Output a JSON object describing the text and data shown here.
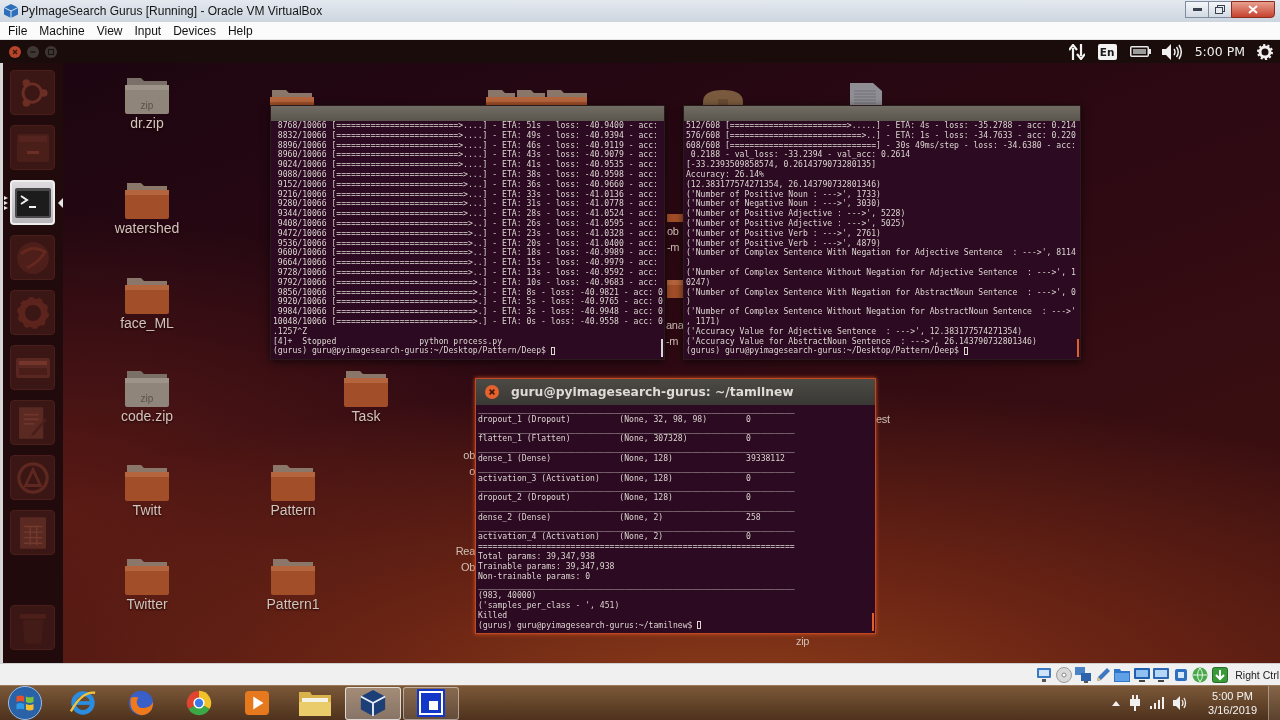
{
  "host_window": {
    "title": "PyImageSearch Gurus [Running] - Oracle VM VirtualBox"
  },
  "menu": [
    "File",
    "Machine",
    "View",
    "Input",
    "Devices",
    "Help"
  ],
  "ubuntu_panel": {
    "keyboard_layout": "En",
    "time": "5:00 PM"
  },
  "launcher": [
    {
      "kind": "dash",
      "selected": false
    },
    {
      "kind": "files",
      "selected": false
    },
    {
      "kind": "terminal",
      "selected": true
    },
    {
      "kind": "browser",
      "selected": false
    },
    {
      "kind": "settings",
      "selected": false
    },
    {
      "kind": "panel",
      "selected": false
    },
    {
      "kind": "editor",
      "selected": false
    },
    {
      "kind": "software",
      "selected": false
    },
    {
      "kind": "spreadsheet",
      "selected": false
    },
    {
      "kind": "trash",
      "selected": false
    }
  ],
  "desktop": {
    "icons": [
      {
        "kind": "zip",
        "label": "dr.zip",
        "icon_text": "zip"
      },
      {
        "kind": "folder"
      },
      {
        "kind": "folder"
      },
      {
        "kind": "folder"
      },
      {
        "kind": "folder"
      },
      {
        "kind": "drive"
      },
      {
        "kind": "file"
      },
      {
        "kind": "folder",
        "label": "watershed"
      },
      {
        "kind": "folder"
      },
      {
        "kind": "folder",
        "label": "face_ML"
      },
      {
        "kind": "folder"
      },
      {
        "kind": "zip",
        "label": "code.zip",
        "icon_text": "zip"
      },
      {
        "kind": "folder",
        "label": "Task"
      },
      {
        "kind": "folder",
        "label": "Twitt"
      },
      {
        "kind": "folder",
        "label": "Pattern"
      },
      {
        "kind": "folder",
        "label": "Twitter"
      },
      {
        "kind": "folder",
        "label": "Pattern1"
      }
    ],
    "label_fragments": [
      {
        "lines": [
          "ob",
          "-m"
        ]
      },
      {
        "lines": [
          "ana",
          "-m"
        ]
      },
      {
        "lines": [
          "est"
        ]
      },
      {
        "lines": [
          "ob",
          "o"
        ]
      },
      {
        "lines": [
          "Rea",
          "Ob"
        ]
      },
      {
        "lines": [
          "zip"
        ]
      }
    ]
  },
  "terminals": [
    {
      "focused": false,
      "lines": [
        " 8768/10066 [=========================>....] - ETA: 51s - loss: -40.9400 - acc:",
        " 8832/10066 [=========================>....] - ETA: 49s - loss: -40.9394 - acc:",
        " 8896/10066 [=========================>....] - ETA: 46s - loss: -40.9119 - acc:",
        " 8960/10066 [=========================>....] - ETA: 43s - loss: -40.9079 - acc:",
        " 9024/10066 [=========================>....] - ETA: 41s - loss: -40.9535 - acc:",
        " 9088/10066 [==========================>...] - ETA: 38s - loss: -40.9598 - acc:",
        " 9152/10066 [==========================>...] - ETA: 36s - loss: -40.9660 - acc:",
        " 9216/10066 [==========================>...] - ETA: 33s - loss: -41.0136 - acc:",
        " 9280/10066 [==========================>...] - ETA: 31s - loss: -41.0778 - acc:",
        " 9344/10066 [==========================>...] - ETA: 28s - loss: -41.0524 - acc:",
        " 9408/10066 [===========================>..] - ETA: 26s - loss: -41.0595 - acc:",
        " 9472/10066 [===========================>..] - ETA: 23s - loss: -41.0328 - acc:",
        " 9536/10066 [===========================>..] - ETA: 20s - loss: -41.0400 - acc:",
        " 9600/10066 [===========================>..] - ETA: 18s - loss: -40.9989 - acc:",
        " 9664/10066 [===========================>..] - ETA: 15s - loss: -40.9979 - acc:",
        " 9728/10066 [===========================>..] - ETA: 13s - loss: -40.9592 - acc:",
        " 9792/10066 [============================>.] - ETA: 10s - loss: -40.9683 - acc:",
        " 9856/10066 [============================>.] - ETA: 8s - loss: -40.9821 - acc: 0",
        " 9920/10066 [============================>.] - ETA: 5s - loss: -40.9765 - acc: 0",
        " 9984/10066 [============================>.] - ETA: 3s - loss: -40.9948 - acc: 0",
        "10048/10066 [============================>.] - ETA: 0s - loss: -40.9558 - acc: 0",
        ".1257^Z",
        "[4]+  Stopped                 python process.py",
        "(gurus) guru@pyimagesearch-gurus:~/Desktop/Pattern/Deep$"
      ]
    },
    {
      "focused": false,
      "lines": [
        "512/608 [========================>.....] - ETA: 4s - loss: -35.2788 - acc: 0.214",
        "576/608 [===========================>..] - ETA: 1s - loss: -34.7633 - acc: 0.220",
        "608/608 [==============================] - 30s 49ms/step - loss: -34.6380 - acc:",
        " 0.2188 - val_loss: -33.2394 - val_acc: 0.2614",
        "[-33.2393509858574, 0.2614379073280135]",
        "Accuracy: 26.14%",
        "(12.383177574271354, 26.143790732801346)",
        "('Number of Positive Noun : --->', 1733)",
        "('Number of Negative Noun : --->', 3030)",
        "('Number of Positive Adjective : --->', 5228)",
        "('Number of Positive Adjective : --->', 5025)",
        "('Number of Positive Verb : --->', 2761)",
        "('Number of Positive Verb : --->', 4879)",
        "('Number of Complex Sentence With Negation for Adjective Sentence  : --->', 8114",
        ")",
        "('Number of Complex Sentence Without Negation for Adjective Sentence  : --->', 1",
        "0247)",
        "('Number of Complex Sentence With Negation for AbstractNoun Sentence  : --->', 0",
        ")",
        "('Number of Complex Sentence Without Negation for AbstractNoun Sentence  : --->'",
        ", 1171)",
        "('Accuracy Value for Adjective Sentence  : --->', 12.383177574271354)",
        "('Accuracy Value for AbstractNoun Sentence  : --->', 26.143790732801346)",
        "(gurus) guru@pyimagesearch-gurus:~/Desktop/Pattern/Deep$"
      ]
    },
    {
      "focused": true,
      "title": "guru@pyimagesearch-gurus: ~/tamilnew",
      "lines": [
        "_________________________________________________________________",
        "dropout_1 (Dropout)          (None, 32, 98, 98)        0",
        "_________________________________________________________________",
        "flatten_1 (Flatten)          (None, 307328)            0",
        "_________________________________________________________________",
        "dense_1 (Dense)              (None, 128)               39338112",
        "_________________________________________________________________",
        "activation_3 (Activation)    (None, 128)               0",
        "_________________________________________________________________",
        "dropout_2 (Dropout)          (None, 128)               0",
        "_________________________________________________________________",
        "dense_2 (Dense)              (None, 2)                 258",
        "_________________________________________________________________",
        "activation_4 (Activation)    (None, 2)                 0",
        "=================================================================",
        "Total params: 39,347,938",
        "Trainable params: 39,347,938",
        "Non-trainable params: 0",
        "_________________________________________________________________",
        "(983, 40000)",
        "('samples_per_class - ', 451)",
        "Killed",
        "(gurus) guru@pyimagesearch-gurus:~/tamilnew$"
      ]
    }
  ],
  "status_bar": {
    "host_key": "Right Ctrl"
  },
  "taskbar": {
    "apps": [
      {
        "kind": "browser_e",
        "selected": false,
        "running": false
      },
      {
        "kind": "browser_fox",
        "selected": false,
        "running": false
      },
      {
        "kind": "browser_circle",
        "selected": false,
        "running": false
      },
      {
        "kind": "media",
        "selected": false,
        "running": false
      },
      {
        "kind": "explorer",
        "selected": false,
        "running": false
      },
      {
        "kind": "virtualbox",
        "selected": true,
        "running": true
      },
      {
        "kind": "app_window",
        "selected": false,
        "running": true
      }
    ],
    "clock": {
      "time": "5:00 PM",
      "date": "3/16/2019"
    }
  }
}
